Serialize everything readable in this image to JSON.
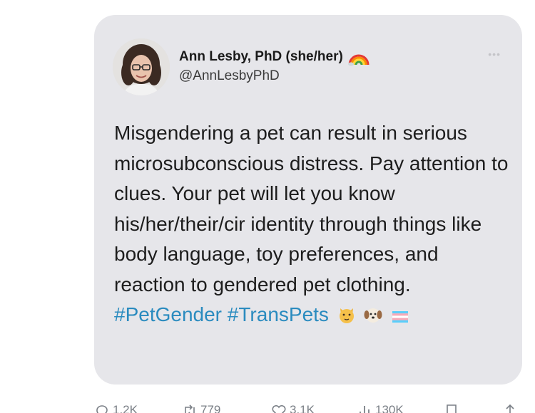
{
  "author": {
    "name": "Ann Lesby, PhD (she/her)",
    "handle": "@AnnLesbyPhD"
  },
  "tweet": {
    "text": "Misgendering a pet can result in serious microsubconscious distress. Pay attention to clues. Your pet will let you know his/her/their/cir identity through things like body language, toy preferences, and reaction to gendered pet clothing.",
    "hashtags": [
      "#PetGender",
      "#TransPets"
    ]
  },
  "actions": {
    "replies": "1.2K",
    "retweets": "779",
    "likes": "3.1K",
    "views": "130K"
  },
  "colors": {
    "card_bg": "#e6e6ea",
    "hashtag": "#2a8bbf",
    "text": "#1d1d1d"
  },
  "icons": [
    "more-icon",
    "rainbow-icon",
    "cat-face-icon",
    "dog-face-icon",
    "transgender-flag-icon",
    "reply-icon",
    "retweet-icon",
    "like-icon",
    "views-icon",
    "bookmark-icon",
    "share-icon"
  ]
}
